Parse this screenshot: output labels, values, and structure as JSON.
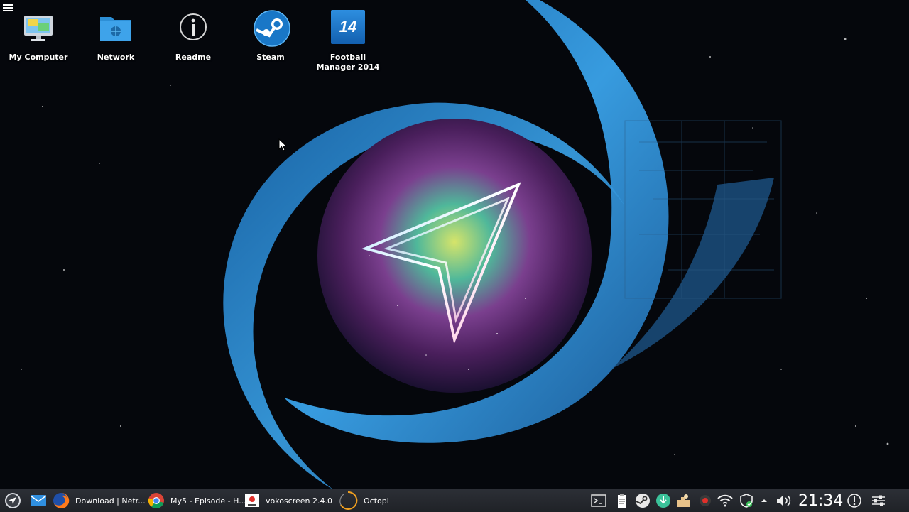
{
  "desktop": {
    "icons": [
      {
        "label": "My Computer",
        "icon": "computer-icon"
      },
      {
        "label": "Network",
        "icon": "network-folder-icon"
      },
      {
        "label": "Readme",
        "icon": "info-icon"
      },
      {
        "label": "Steam",
        "icon": "steam-icon"
      },
      {
        "label": "Football\nManager 2014",
        "icon": "fm14-icon",
        "badge": "14"
      }
    ]
  },
  "taskbar": {
    "tasks": [
      {
        "label": "Download | Netr...",
        "icon": "firefox-icon"
      },
      {
        "label": "My5 - Episode - H...",
        "icon": "chrome-icon"
      },
      {
        "label": "vokoscreen 2.4.0",
        "icon": "vokoscreen-icon"
      },
      {
        "label": "Octopi",
        "icon": "octopi-icon"
      }
    ],
    "clock": "21:34"
  },
  "colors": {
    "accent_blue": "#2f8fd8",
    "taskbar_bg": "#24272d"
  }
}
